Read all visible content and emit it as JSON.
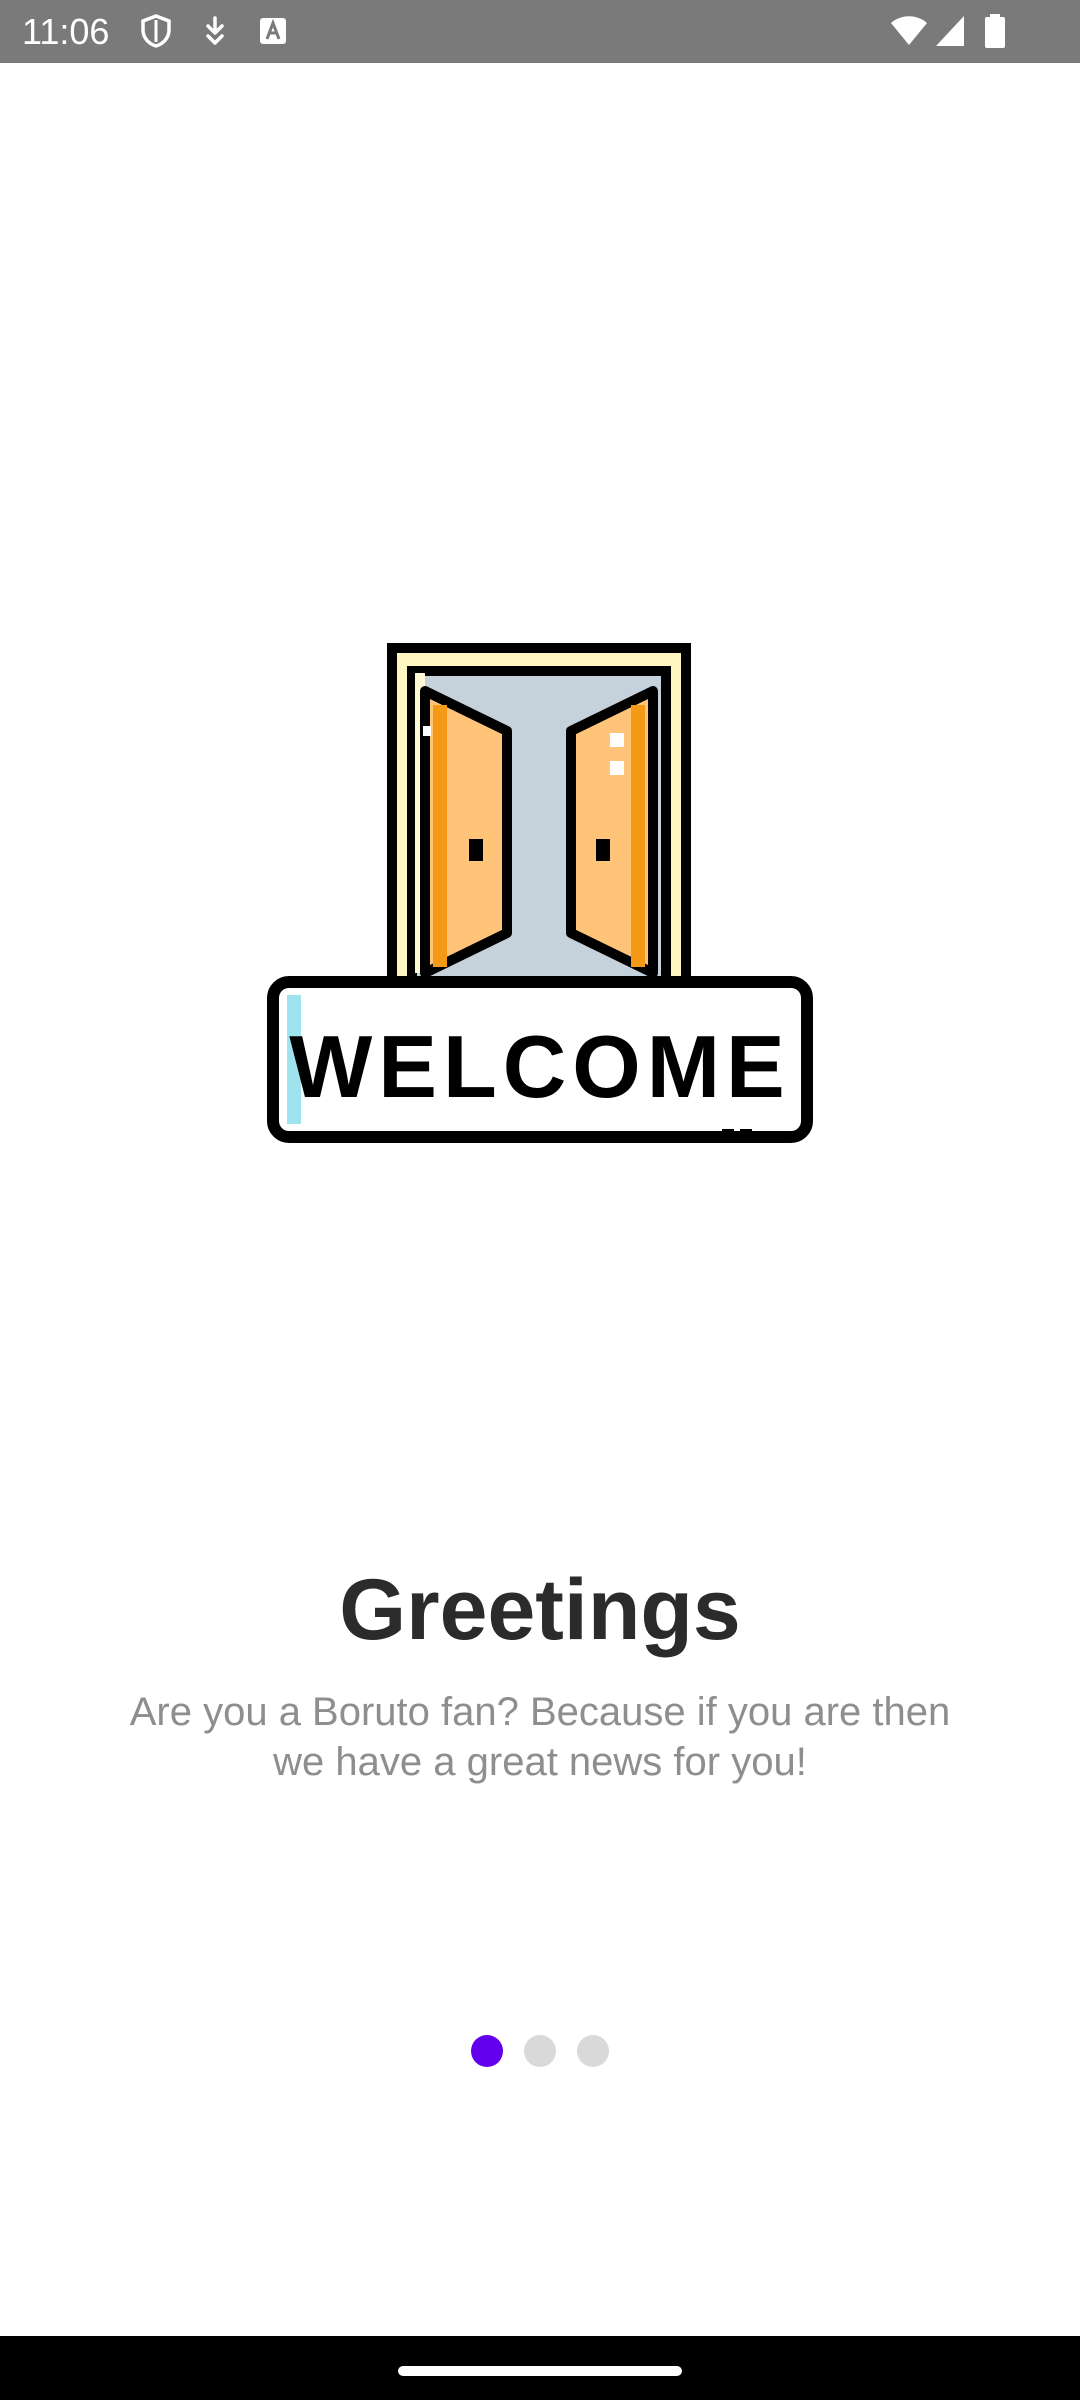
{
  "status_bar": {
    "time": "11:06",
    "left_icons": [
      "shield-icon",
      "download-icon",
      "text-a-icon"
    ],
    "right_icons": [
      "wifi-icon",
      "signal-icon",
      "battery-icon"
    ]
  },
  "onboarding": {
    "illustration_icon": "welcome-door-icon",
    "illustration_sign_text": "WELCOME",
    "title": "Greetings",
    "description": "Are you a Boruto fan? Because if you are then we have a great news for you!",
    "pager": {
      "total_pages": 3,
      "current_page": 1,
      "active_color": "#6200ee",
      "inactive_color": "#d9d9d9"
    }
  },
  "navigation_bar": {
    "handle_icon": "home-handle-icon"
  }
}
